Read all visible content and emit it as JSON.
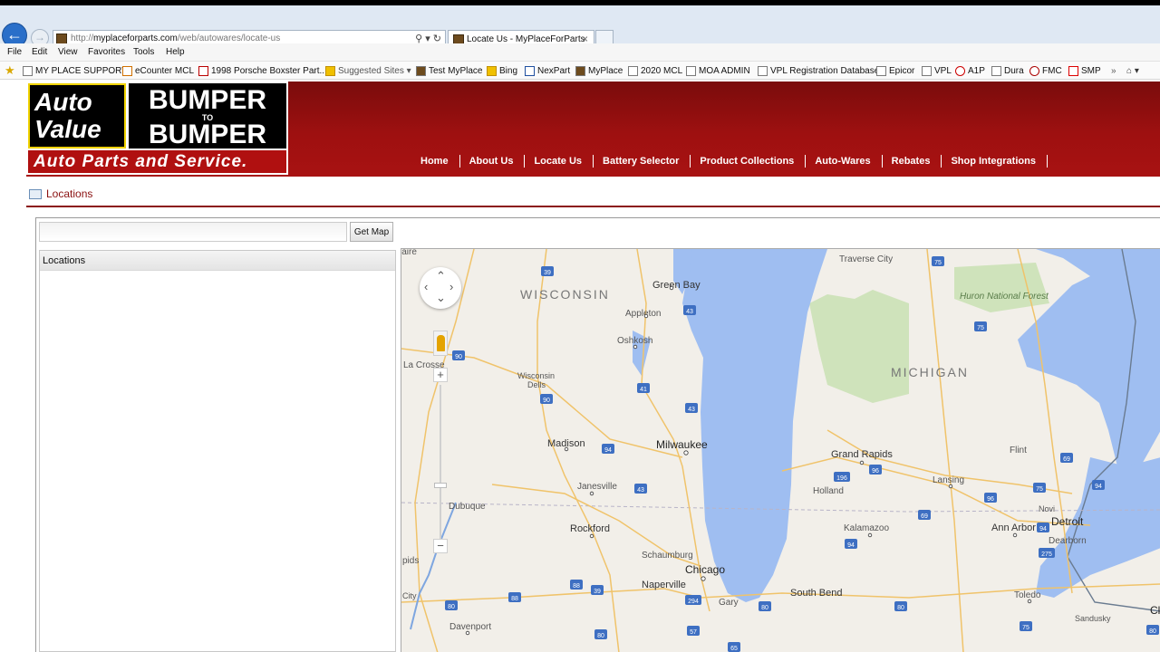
{
  "browser": {
    "url_prefix": "http://",
    "url_domain": "myplaceforparts.com",
    "url_path": "/web/autowares/locate-us",
    "tab_title": "Locate Us - MyPlaceForParts",
    "tab_close": "×",
    "menu": [
      "File",
      "Edit",
      "View",
      "Favorites",
      "Tools",
      "Help"
    ],
    "favorites": [
      "MY PLACE SUPPORT",
      "eCounter MCL",
      "1998 Porsche Boxster Part...",
      "Suggested Sites ▾",
      "Test MyPlace",
      "Bing",
      "NexPart",
      "MyPlace",
      "2020 MCL",
      "MOA ADMIN",
      "VPL Registration Database",
      "Epicor",
      "VPL",
      "A1P",
      "Dura",
      "FMC",
      "SMP"
    ]
  },
  "brand": {
    "auto_value_line1": "Auto",
    "auto_value_line2": "Value",
    "btb_top": "BUMPER",
    "btb_to": "TO",
    "btb_bottom": "BUMPER",
    "tagline": "Auto Parts and Service."
  },
  "nav": [
    "Home",
    "About Us",
    "Locate Us",
    "Battery Selector",
    "Product Collections",
    "Auto-Wares",
    "Rebates",
    "Shop Integrations"
  ],
  "breadcrumb": "Locations",
  "search": {
    "value": "",
    "button": "Get Map"
  },
  "locations_header": "Locations",
  "map": {
    "water_color": "#9fbef1",
    "land_color": "#f2efe9",
    "state_labels": [
      "WISCONSIN",
      "MICHIGAN"
    ],
    "cities": [
      "Traverse City",
      "Green Bay",
      "Appleton",
      "Oshkosh",
      "La Crosse",
      "Wisconsin",
      "Dells",
      "Madison",
      "Milwaukee",
      "Grand Rapids",
      "Flint",
      "Lansing",
      "Holland",
      "Janesville",
      "Dubuque",
      "Rockford",
      "Kalamazoo",
      "Ann Arbor",
      "Detroit",
      "Novi",
      "Dearborn",
      "Schaumburg",
      "Chicago",
      "Naperville",
      "South Bend",
      "Gary",
      "Toledo",
      "Davenport",
      "Sandusky",
      "City",
      "pids",
      "laire"
    ],
    "park_label": "Huron National Forest",
    "highways": [
      "39",
      "75",
      "43",
      "75",
      "90",
      "41",
      "43",
      "94",
      "69",
      "96",
      "196",
      "43",
      "96",
      "94",
      "69",
      "96",
      "75",
      "94",
      "39",
      "88",
      "80",
      "88",
      "39",
      "294",
      "80",
      "90",
      "94",
      "80",
      "275",
      "75",
      "57",
      "80",
      "65"
    ]
  }
}
